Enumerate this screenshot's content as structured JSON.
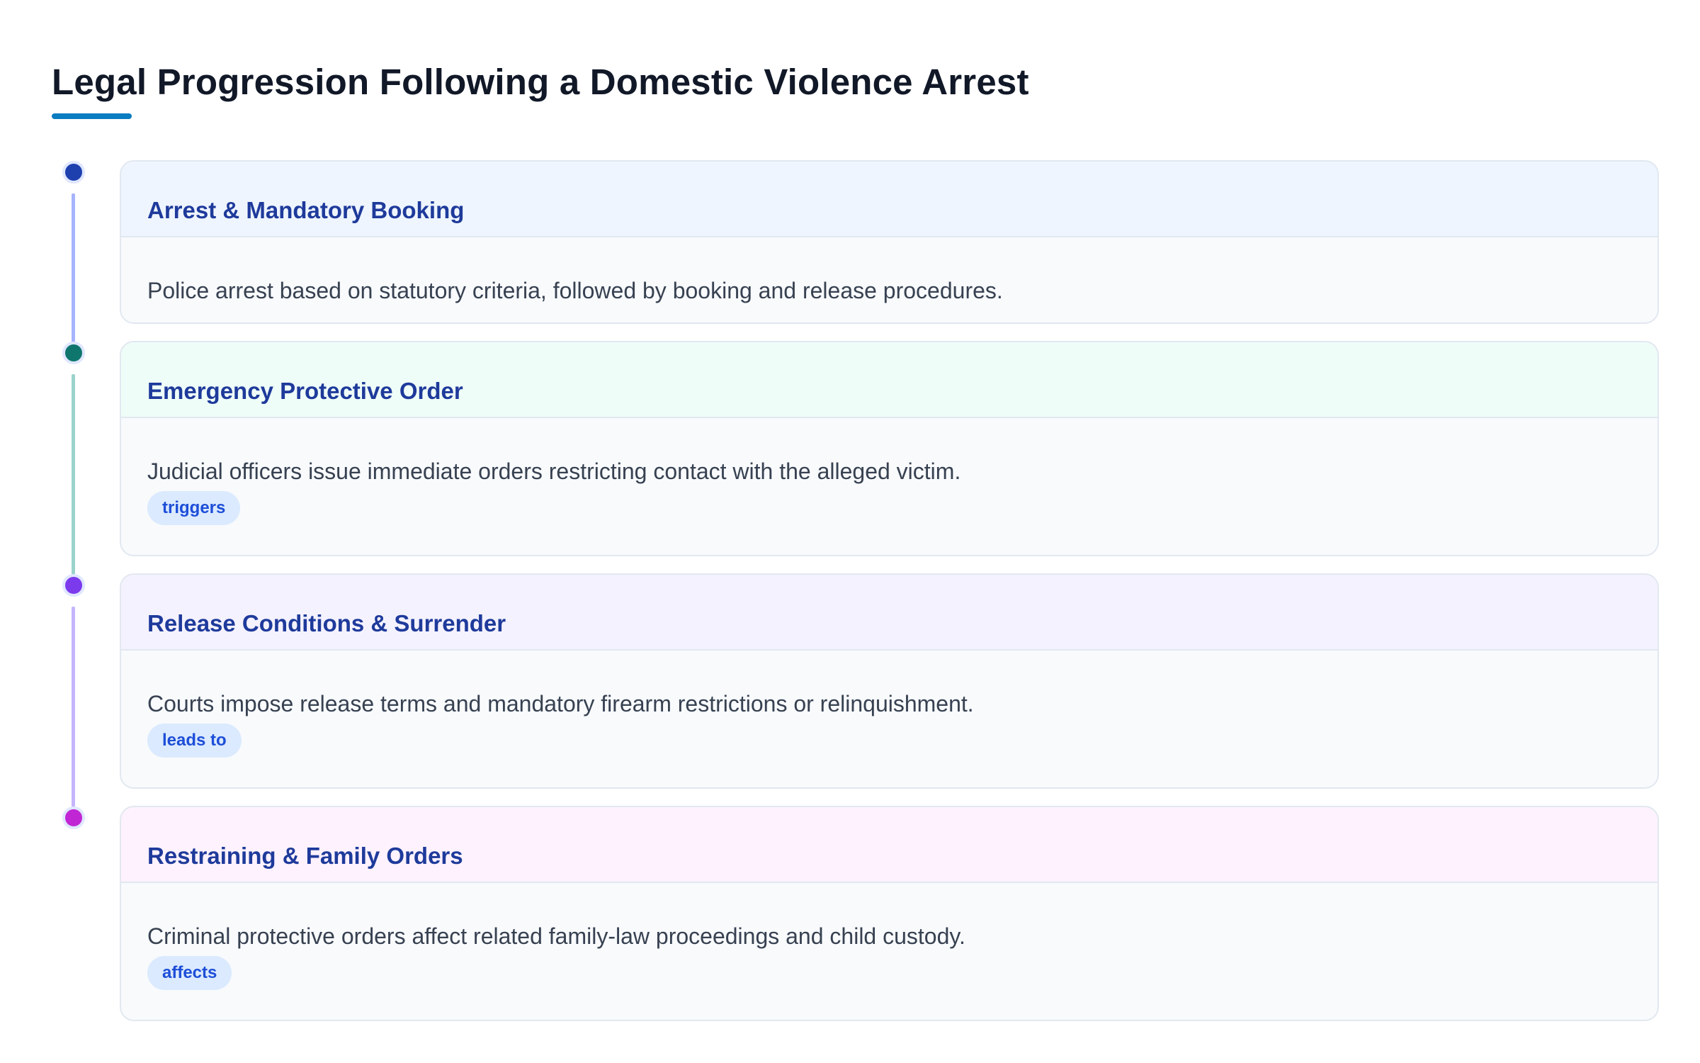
{
  "title": "Legal Progression Following a Domestic Violence Arrest",
  "colors": {
    "accent_underline": "#0a7cc1",
    "card_title": "#1e3a9b",
    "badge_bg": "#dbeafe",
    "badge_text": "#1d4ed8"
  },
  "steps": [
    {
      "title": "Arrest & Mandatory Booking",
      "description": "Police arrest based on statutory criteria, followed by booking and release procedures.",
      "badge": "",
      "dot_color": "#1e40af",
      "line_color": "#a5b4fc",
      "header_bg": "#eef5ff"
    },
    {
      "title": "Emergency Protective Order",
      "description": "Judicial officers issue immediate orders restricting contact with the alleged victim.",
      "badge": "triggers",
      "dot_color": "#0f766e",
      "line_color": "#99d3cc",
      "header_bg": "#effdf8"
    },
    {
      "title": "Release Conditions & Surrender",
      "description": "Courts impose release terms and mandatory firearm restrictions or relinquishment.",
      "badge": "leads to",
      "dot_color": "#7c3aed",
      "line_color": "#c4b5fd",
      "header_bg": "#f4f2fe"
    },
    {
      "title": "Restraining & Family Orders",
      "description": "Criminal protective orders affect related family-law proceedings and child custody.",
      "badge": "affects",
      "dot_color": "#c026d3",
      "line_color": "",
      "header_bg": "#fdf2fd"
    }
  ]
}
